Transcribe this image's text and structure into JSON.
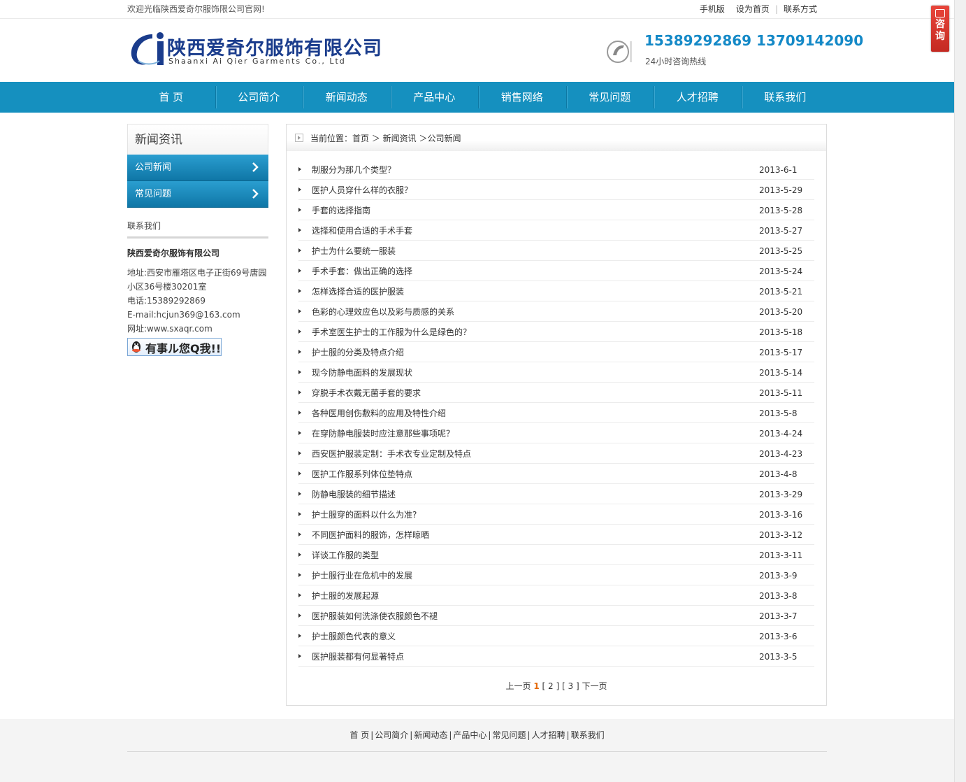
{
  "topbar": {
    "welcome": "欢迎光临陕西爱奇尔服饰限公司官网!",
    "links": [
      "手机版",
      "设为首页",
      "联系方式"
    ]
  },
  "header": {
    "logo_cn": "陕西爱奇尔服饰有限公司",
    "logo_en": "Shaanxi Ai Qier Garments Co., Ltd",
    "phones": "15389292869  13709142090",
    "hotline": "24小时咨询热线"
  },
  "nav": [
    "首 页",
    "公司简介",
    "新闻动态",
    "产品中心",
    "销售网络",
    "常见问题",
    "人才招聘",
    "联系我们"
  ],
  "sidebar": {
    "title": "新闻资讯",
    "items": [
      "公司新闻",
      "常见问题"
    ],
    "contact_title": "联系我们",
    "company": "陕西爱奇尔服饰有限公司",
    "address1": "地址:西安市雁塔区电子正街69号唐园",
    "address2": "小区36号楼30201室",
    "phone": "电话:15389292869",
    "email": "E-mail:hcjun369@163.com",
    "website": "网址:www.sxaqr.com",
    "qq_label": "有事ル您Q我!!"
  },
  "breadcrumb": "当前位置：首页 ＞ 新闻资讯 ＞公司新闻",
  "news": [
    {
      "title": "制服分为那几个类型？",
      "date": "2013-6-1"
    },
    {
      "title": "医护人员穿什么样的衣服？",
      "date": "2013-5-29"
    },
    {
      "title": "手套的选择指南",
      "date": "2013-5-28"
    },
    {
      "title": "选择和使用合适的手术手套",
      "date": "2013-5-27"
    },
    {
      "title": "护士为什么要统一服装",
      "date": "2013-5-25"
    },
    {
      "title": "手术手套：做出正确的选择",
      "date": "2013-5-24"
    },
    {
      "title": "怎样选择合适的医护服装",
      "date": "2013-5-21"
    },
    {
      "title": "色彩的心理效应色以及彩与质感的关系",
      "date": "2013-5-20"
    },
    {
      "title": "手术室医生护士的工作服为什么是绿色的？",
      "date": "2013-5-18"
    },
    {
      "title": "护士服的分类及特点介绍",
      "date": "2013-5-17"
    },
    {
      "title": "现今防静电面料的发展现状",
      "date": "2013-5-14"
    },
    {
      "title": "穿脱手术衣戴无菌手套的要求",
      "date": "2013-5-11"
    },
    {
      "title": "各种医用创伤敷料的应用及特性介绍",
      "date": "2013-5-8"
    },
    {
      "title": "在穿防静电服装时应注意那些事项呢？",
      "date": "2013-4-24"
    },
    {
      "title": "西安医护服装定制：手术衣专业定制及特点",
      "date": "2013-4-23"
    },
    {
      "title": "医护工作服系列体位垫特点",
      "date": "2013-4-8"
    },
    {
      "title": "防静电服装的细节描述",
      "date": "2013-3-29"
    },
    {
      "title": "护士服穿的面料以什么为准?",
      "date": "2013-3-16"
    },
    {
      "title": "不同医护面料的服饰，怎样晾晒",
      "date": "2013-3-12"
    },
    {
      "title": "详谈工作服的类型",
      "date": "2013-3-11"
    },
    {
      "title": "护士服行业在危机中的发展",
      "date": "2013-3-9"
    },
    {
      "title": "护士服的发展起源",
      "date": "2013-3-8"
    },
    {
      "title": "医护服装如何洗涤使衣服颜色不褪",
      "date": "2013-3-7"
    },
    {
      "title": "护士服颜色代表的意义",
      "date": "2013-3-6"
    },
    {
      "title": "医护服装都有何显著特点",
      "date": "2013-3-5"
    }
  ],
  "pager": {
    "prev": "上一页",
    "current": "1",
    "p2": "[ 2 ]",
    "p3": "[ 3 ]",
    "next": "下一页"
  },
  "footer_nav": [
    "首 页",
    "公司简介",
    "新闻动态",
    "产品中心",
    "常见问题",
    "人才招聘",
    "联系我们"
  ],
  "consult": "咨询",
  "colors": {
    "nav": "#1590bf",
    "phone": "#1489c7",
    "logo": "#1a3c8c",
    "consult": "#d2342b",
    "current_page": "#e56a0a"
  }
}
